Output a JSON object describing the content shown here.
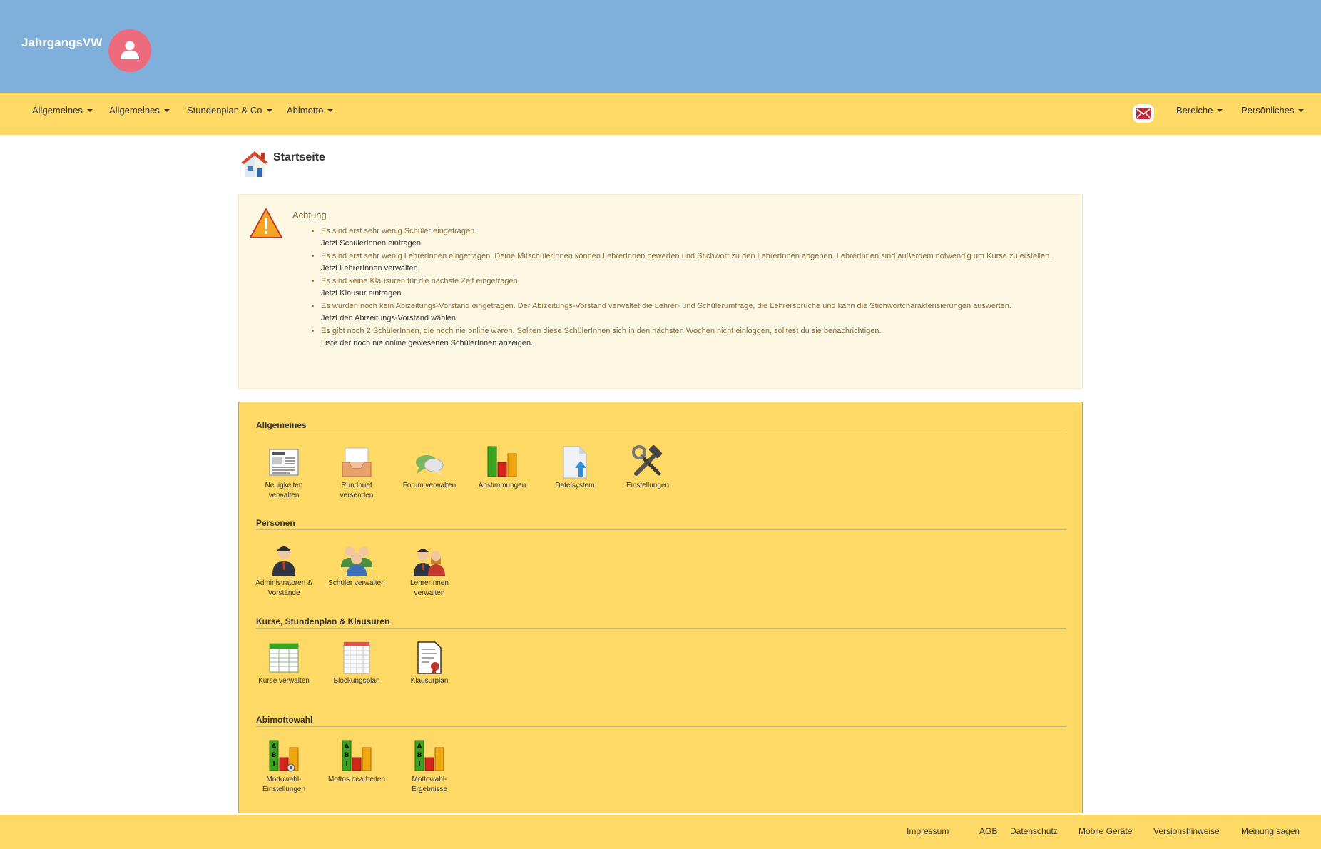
{
  "brand": {
    "name": "JahrgangsVW"
  },
  "nav": {
    "left": [
      "Allgemeines",
      "Allgemeines",
      "Stundenplan & Co",
      "Abimotto"
    ],
    "right": [
      "Bereiche",
      "Persönliches"
    ]
  },
  "page": {
    "title": "Startseite"
  },
  "alert": {
    "title": "Achtung",
    "items": [
      {
        "text": "Es sind erst sehr wenig Schüler eingetragen.",
        "action": "Jetzt SchülerInnen eintragen"
      },
      {
        "text": "Es sind erst sehr wenig LehrerInnen eingetragen. Deine MitschülerInnen können LehrerInnen bewerten und Stichwort zu den LehrerInnen abgeben. LehrerInnen sind außerdem notwendig um Kurse zu erstellen.",
        "action": "Jetzt LehrerInnen verwalten"
      },
      {
        "text": "Es sind keine Klausuren für die nächste Zeit eingetragen.",
        "action": "Jetzt Klausur eintragen"
      },
      {
        "text": "Es wurden noch kein Abizeitungs-Vorstand eingetragen. Der Abizeitungs-Vorstand verwaltet die Lehrer- und Schülerumfrage, die Lehrersprüche und kann die Stichwortcharakterisierungen auswerten.",
        "action": "Jetzt den Abizeitungs-Vorstand wählen"
      },
      {
        "text": "Es gibt noch 2 SchülerInnen, die noch nie online waren. Sollten diese SchülerInnen sich in den nächsten Wochen nicht einloggen, solltest du sie benachrichtigen.",
        "action": "Liste der noch nie online gewesenen SchülerInnen anzeigen."
      }
    ]
  },
  "sections": [
    {
      "title": "Allgemeines",
      "tiles": [
        {
          "label": "Neuigkeiten verwalten",
          "icon": "newspaper-icon"
        },
        {
          "label": "Rundbrief versenden",
          "icon": "inbox-tray-icon"
        },
        {
          "label": "Forum verwalten",
          "icon": "speech-bubbles-icon"
        },
        {
          "label": "Abstimmungen",
          "icon": "bar-chart-icon"
        },
        {
          "label": "Dateisystem",
          "icon": "file-upload-icon"
        },
        {
          "label": "Einstellungen",
          "icon": "tools-icon"
        }
      ]
    },
    {
      "title": "Personen",
      "tiles": [
        {
          "label": "Administratoren & Vorstände",
          "icon": "admin-person-icon"
        },
        {
          "label": "Schüler verwalten",
          "icon": "student-group-icon"
        },
        {
          "label": "LehrerInnen verwalten",
          "icon": "teachers-icon"
        }
      ]
    },
    {
      "title": "Kurse, Stundenplan & Klausuren",
      "tiles": [
        {
          "label": "Kurse verwalten",
          "icon": "spreadsheet-icon"
        },
        {
          "label": "Blockungsplan",
          "icon": "grid-sheet-icon"
        },
        {
          "label": "Klausurplan",
          "icon": "certificate-icon"
        }
      ]
    },
    {
      "title": "Abimottowahl",
      "tiles": [
        {
          "label": "Mottowahl-Einstellungen",
          "icon": "abi-chart-settings-icon"
        },
        {
          "label": "Mottos bearbeiten",
          "icon": "abi-chart-icon"
        },
        {
          "label": "Mottowahl-Ergebnisse",
          "icon": "abi-chart-results-icon"
        }
      ]
    }
  ],
  "footer": [
    "Impressum",
    "AGB",
    "Datenschutz",
    "Mobile Geräte",
    "Versionshinweise",
    "Meinung sagen"
  ],
  "colors": {
    "header": "#7fb0dc",
    "navbar": "#ffd966",
    "avatar": "#ee6b7e",
    "alert_bg": "#fcf8e3",
    "alert_text": "#8a6d3b"
  }
}
